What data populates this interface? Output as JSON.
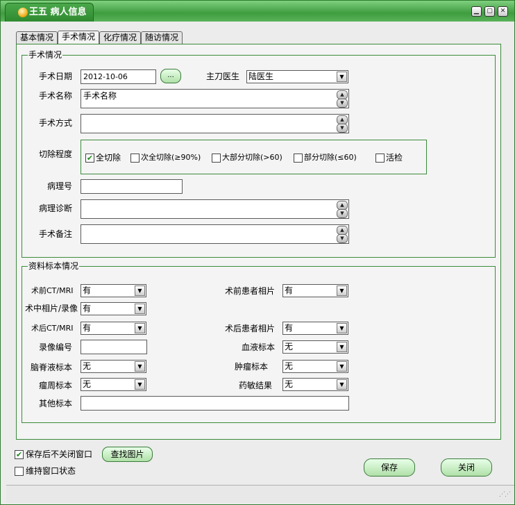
{
  "window": {
    "title": "王五 病人信息",
    "btn_minimize": "▁",
    "btn_maximize": "▢",
    "btn_close": "✕"
  },
  "tabs": [
    "基本情况",
    "手术情况",
    "化疗情况",
    "随访情况"
  ],
  "surgery": {
    "group_title": "手术情况",
    "date_label": "手术日期",
    "date_value": "2012-10-06",
    "date_button": "...",
    "surgeon_label": "主刀医生",
    "surgeon_value": "陆医生",
    "name_label": "手术名称",
    "name_value": "手术名称",
    "method_label": "手术方式",
    "method_value": "",
    "resection_label": "切除程度",
    "resection_options": [
      {
        "label": "全切除",
        "checked": true
      },
      {
        "label": "次全切除(≥90%)",
        "checked": false
      },
      {
        "label": "大部分切除(>60)",
        "checked": false
      },
      {
        "label": "部分切除(≤60)",
        "checked": false
      },
      {
        "label": "活检",
        "checked": false
      }
    ],
    "pathology_no_label": "病理号",
    "pathology_no_value": "",
    "pathology_dx_label": "病理诊断",
    "pathology_dx_value": "",
    "notes_label": "手术备注",
    "notes_value": ""
  },
  "specimen": {
    "group_title": "资料标本情况",
    "preop_ct_label": "术前CT/MRI",
    "preop_ct_value": "有",
    "preop_photo_label": "术前患者相片",
    "preop_photo_value": "有",
    "intraop_photo_label": "术中相片/录像",
    "intraop_photo_value": "有",
    "postop_ct_label": "术后CT/MRI",
    "postop_ct_value": "有",
    "postop_photo_label": "术后患者相片",
    "postop_photo_value": "有",
    "video_no_label": "录像编号",
    "video_no_value": "",
    "blood_label": "血液标本",
    "blood_value": "无",
    "csf_label": "脑脊液标本",
    "csf_value": "无",
    "tumor_label": "肿瘤标本",
    "tumor_value": "无",
    "peritumor_label": "瘤周标本",
    "peritumor_value": "无",
    "drug_label": "药敏结果",
    "drug_value": "无",
    "other_label": "其他标本",
    "other_value": ""
  },
  "footer": {
    "keep_open_label": "保存后不关闭窗口",
    "keep_open_checked": true,
    "keep_state_label": "维持窗口状态",
    "keep_state_checked": false,
    "find_image_button": "查找图片",
    "save_button": "保存",
    "close_button": "关闭"
  }
}
